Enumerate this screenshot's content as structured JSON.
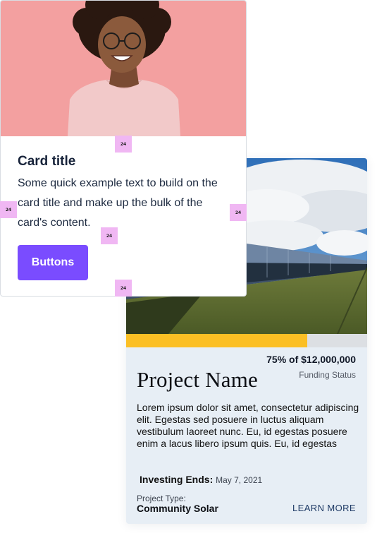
{
  "card": {
    "title": "Card title",
    "text": "Some quick example text to build on the card title and make up the bulk of the card's content.",
    "button_label": "Buttons",
    "image_icon": "portrait-photo",
    "colors": {
      "button": "#7a4cff",
      "image_bg": "#f3a0a0"
    }
  },
  "spacing_markers": {
    "image_bottom": "24",
    "left": "24",
    "right": "24",
    "text_bottom": "24",
    "card_bottom": "24"
  },
  "project": {
    "funding_amount": "75% of $12,000,000",
    "funding_label": "Funding Status",
    "progress_percent": 75,
    "name": "Project Name",
    "description": "Lorem ipsum dolor sit amet, consectetur adipiscing elit. Egestas sed posuere in luctus aliquam vestibulum laoreet nunc. Eu, id egestas posuere enim a lacus libero ipsum quis. Eu, id egestas",
    "investing_ends_label": "Investing Ends:",
    "investing_ends_date": "May 7, 2021",
    "project_type_label": "Project Type:",
    "project_type_value": "Community Solar",
    "learn_more": "LEARN MORE",
    "image_icon": "solar-farm-photo",
    "colors": {
      "progress_fill": "#fbbf24",
      "progress_track": "#dcdfe3",
      "card_bg": "#e7eef5"
    }
  }
}
